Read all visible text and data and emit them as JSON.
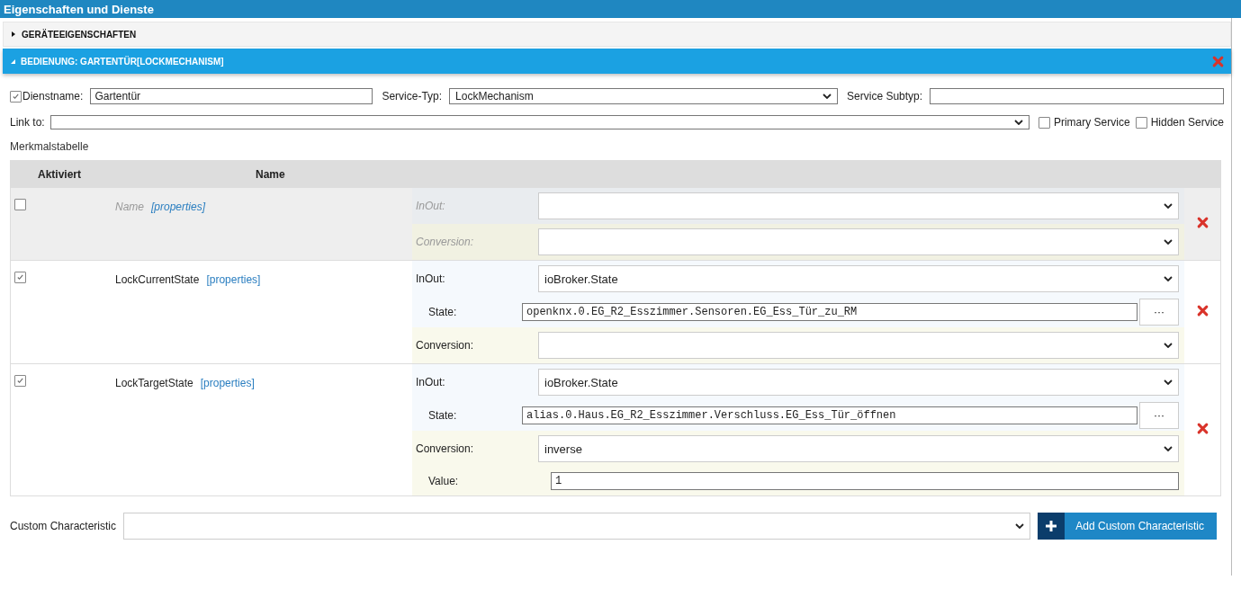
{
  "window": {
    "title": "Eigenschaften und Dienste"
  },
  "sections": [
    {
      "title": "GERÄTEEIGENSCHAFTEN",
      "expanded": false
    },
    {
      "title": "BEDIENUNG: GARTENTÜR[LOCKMECHANISM]",
      "expanded": true
    }
  ],
  "service": {
    "enabled": true,
    "name_label": "Dienstname:",
    "name": "Gartentür",
    "type_label": "Service-Typ:",
    "type": "LockMechanism",
    "subtype_label": "Service Subtyp:",
    "link_label": "Link to:",
    "primary": {
      "label": "Primary Service",
      "checked": false
    },
    "hidden": {
      "label": "Hidden Service",
      "checked": false
    }
  },
  "table": {
    "title": "Merkmalstabelle",
    "columns": [
      "Aktiviert",
      "Name"
    ],
    "rows": [
      {
        "enabled": false,
        "name": "Name",
        "link": "[properties]",
        "fields": [
          {
            "kind": "inout",
            "label": "InOut:"
          },
          {
            "kind": "conversion",
            "label": "Conversion:"
          }
        ]
      },
      {
        "enabled": true,
        "name": "LockCurrentState",
        "link": "[properties]",
        "fields": [
          {
            "kind": "inout",
            "label": "InOut:",
            "value": "ioBroker.State"
          },
          {
            "kind": "state",
            "label": "State:",
            "value": "openknx.0.EG_R2_Esszimmer.Sensoren.EG_Ess_Tür_zu_RM",
            "button": "···"
          },
          {
            "kind": "conversion",
            "label": "Conversion:"
          }
        ]
      },
      {
        "enabled": true,
        "name": "LockTargetState",
        "link": "[properties]",
        "fields": [
          {
            "kind": "inout",
            "label": "InOut:",
            "value": "ioBroker.State"
          },
          {
            "kind": "state",
            "label": "State:",
            "value": "alias.0.Haus.EG_R2_Esszimmer.Verschluss.EG_Ess_Tür_öffnen",
            "button": "···"
          },
          {
            "kind": "conversion",
            "label": "Conversion:",
            "value": "inverse"
          },
          {
            "kind": "value",
            "label": "Value:",
            "value": "1"
          }
        ]
      }
    ]
  },
  "custom": {
    "label": "Custom Characteristic",
    "button": "Add Custom Characteristic"
  }
}
